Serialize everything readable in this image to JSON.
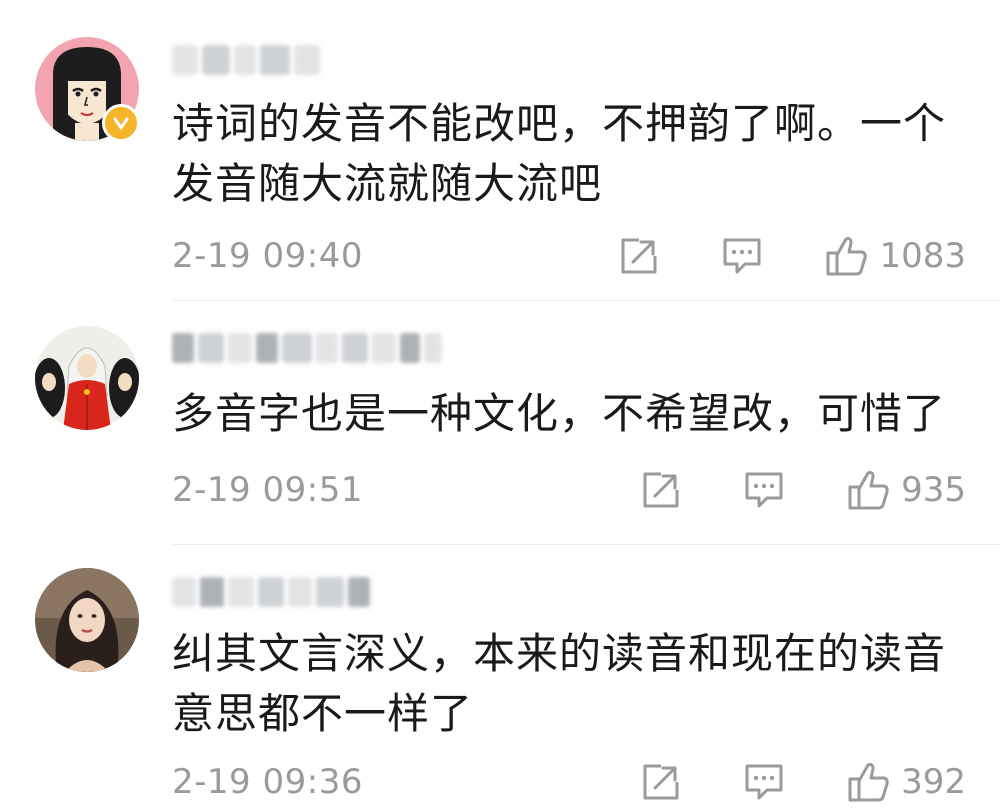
{
  "comments": [
    {
      "text": "诗词的发音不能改吧，不押韵了啊。一个发音随大流就随大流吧",
      "timestamp": "2-19 09:40",
      "likes": "1083",
      "avatar_icon": "cartoon-girl-avatar",
      "verified": true
    },
    {
      "text": "多音字也是一种文化，不希望改，可惜了",
      "timestamp": "2-19 09:51",
      "likes": "935",
      "avatar_icon": "anime-characters-avatar",
      "verified": false
    },
    {
      "text": "纠其文言深义，本来的读音和现在的读音意思都不一样了",
      "timestamp": "2-19 09:36",
      "likes": "392",
      "avatar_icon": "woman-photo-avatar",
      "verified": false
    }
  ],
  "icons": {
    "share": "share-icon",
    "comment": "comment-icon",
    "like": "thumbs-up-icon",
    "verified": "verified-badge-icon"
  },
  "colors": {
    "text": "#1a1a1a",
    "meta": "#9a9a9a",
    "verified": "#f6b428"
  }
}
